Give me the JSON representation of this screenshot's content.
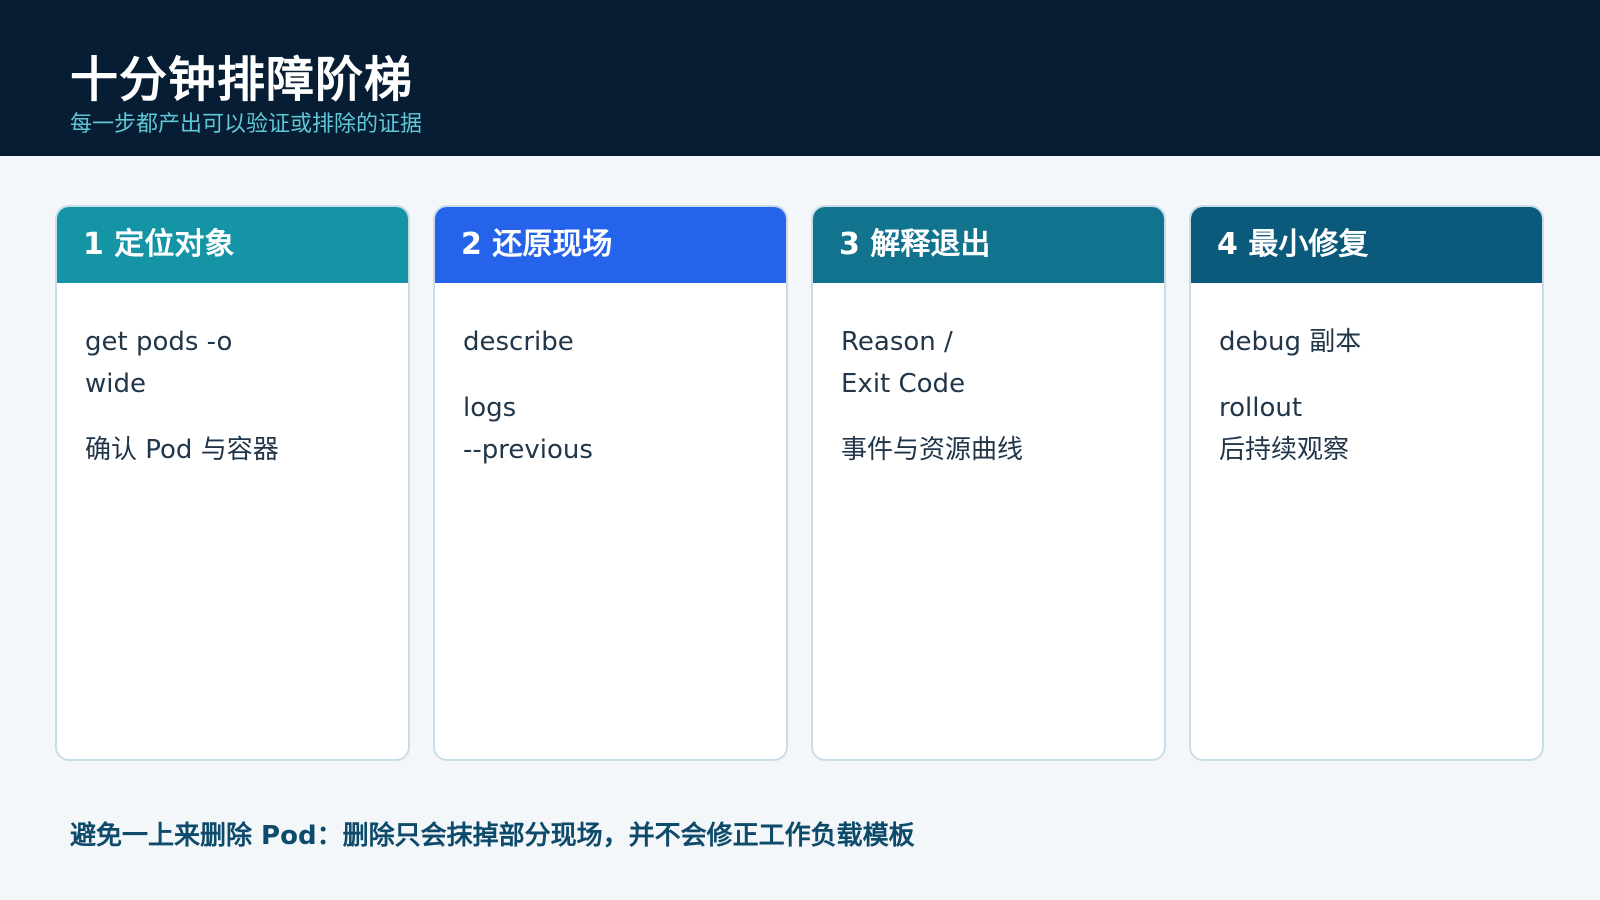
{
  "header": {
    "title": "十分钟排障阶梯",
    "subtitle": "每一步都产出可以验证或排除的证据"
  },
  "cards": [
    {
      "heading": "1 定位对象",
      "lines": [
        "get pods -o\nwide",
        "确认 Pod 与容器"
      ]
    },
    {
      "heading": "2 还原现场",
      "lines": [
        "describe",
        "logs\n--previous"
      ]
    },
    {
      "heading": "3 解释退出",
      "lines": [
        "Reason /\nExit Code",
        "事件与资源曲线"
      ]
    },
    {
      "heading": "4 最小修复",
      "lines": [
        "debug 副本",
        "rollout\n后持续观察"
      ]
    }
  ],
  "footer": {
    "note": "避免一上来删除 Pod：删除只会抹掉部分现场，并不会修正工作负载模板"
  },
  "colors": {
    "header_bg": "#071d33",
    "step1": "#1594a6",
    "step2": "#2563eb",
    "step3": "#11738d",
    "step4": "#0c5a7b"
  }
}
